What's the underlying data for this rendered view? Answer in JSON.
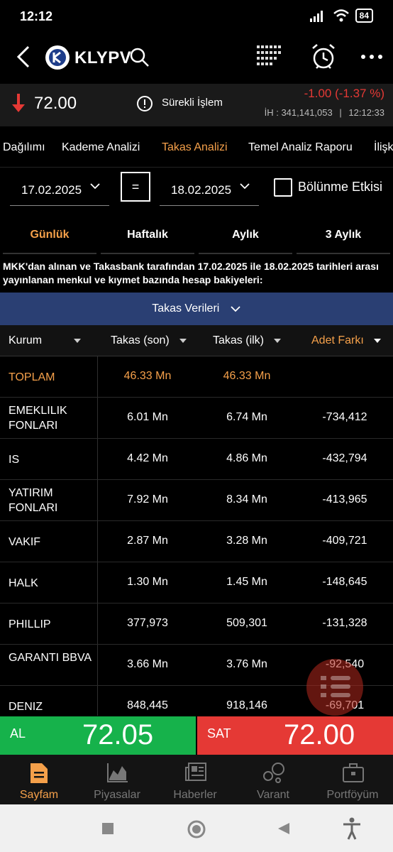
{
  "status": {
    "time": "12:12",
    "battery": "84"
  },
  "header": {
    "logo": "KLYPV",
    "icons": [
      "back-icon",
      "search-icon",
      "grid-icon",
      "alarm-clock-icon",
      "more-icon"
    ]
  },
  "price": {
    "last": "72.00",
    "state": "Sürekli İşlem",
    "change": "-1.00 (-1.37 %)",
    "ih": "İH : 341,141,053",
    "time": "12:12:33"
  },
  "tabs": [
    "Dağılımı",
    "Kademe Analizi",
    "Takas Analizi",
    "Temel Analiz Raporu",
    "İlişk"
  ],
  "dates": {
    "from": "17.02.2025",
    "eq": "=",
    "to": "18.02.2025",
    "checkbox_label": "Bölünme Etkisi"
  },
  "periods": [
    "Günlük",
    "Haftalık",
    "Aylık",
    "3 Aylık"
  ],
  "info": "MKK'dan alınan ve Takasbank tarafından 17.02.2025 ile 18.02.2025 tarihleri arası yayınlanan menkul ve kıymet bazında hesap bakiyeleri:",
  "section": "Takas Verileri",
  "columns": [
    "Kurum",
    "Takas (son)",
    "Takas (ilk)",
    "Adet Farkı"
  ],
  "rows": [
    {
      "name": "TOPLAM",
      "son": "46.33 Mn",
      "ilk": "46.33 Mn",
      "fark": ""
    },
    {
      "name": "EMEKLILIK FONLARI",
      "son": "6.01 Mn",
      "ilk": "6.74 Mn",
      "fark": "-734,412"
    },
    {
      "name": "IS",
      "son": "4.42 Mn",
      "ilk": "4.86 Mn",
      "fark": "-432,794"
    },
    {
      "name": "YATIRIM FONLARI",
      "son": "7.92 Mn",
      "ilk": "8.34 Mn",
      "fark": "-413,965"
    },
    {
      "name": "VAKIF",
      "son": "2.87 Mn",
      "ilk": "3.28 Mn",
      "fark": "-409,721"
    },
    {
      "name": "HALK",
      "son": "1.30 Mn",
      "ilk": "1.45 Mn",
      "fark": "-148,645"
    },
    {
      "name": "PHILLIP",
      "son": "377,973",
      "ilk": "509,301",
      "fark": "-131,328"
    },
    {
      "name": "GARANTI BBVA",
      "son": "3.66 Mn",
      "ilk": "3.76 Mn",
      "fark": "-92,540"
    },
    {
      "name": "DENIZ",
      "son": "848,445",
      "ilk": "918,146",
      "fark": "-69,701"
    }
  ],
  "trade": {
    "buy_label": "AL",
    "buy_price": "72.05",
    "sell_label": "SAT",
    "sell_price": "72.00"
  },
  "nav": [
    "Sayfam",
    "Piyasalar",
    "Haberler",
    "Varant",
    "Portföyüm"
  ],
  "colors": {
    "accent": "#f5a04a",
    "buy": "#16b24b",
    "sell": "#e53935",
    "section": "#2a3f73"
  }
}
